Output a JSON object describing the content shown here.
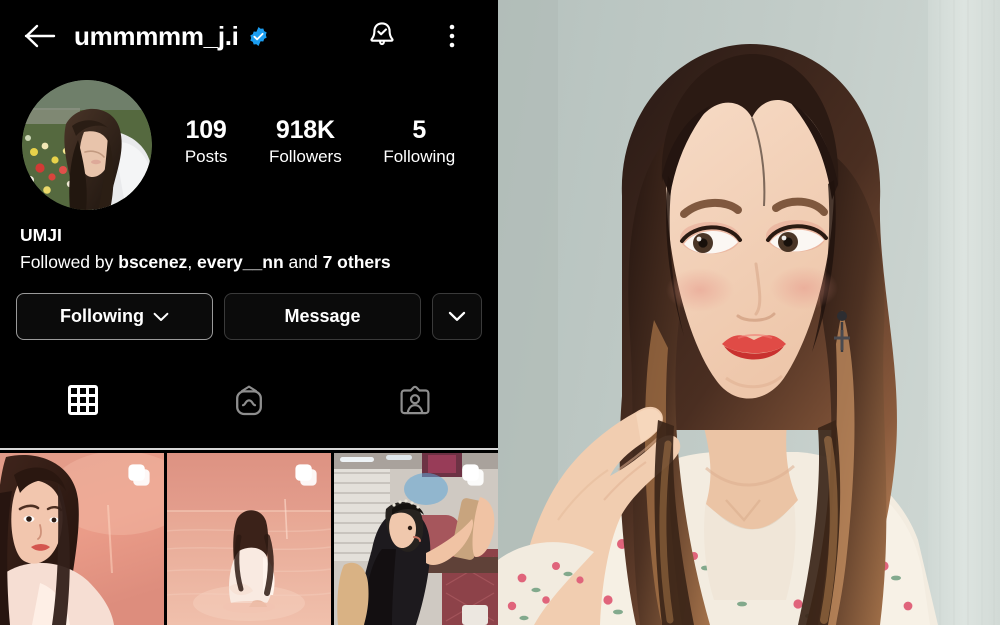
{
  "app": {
    "name": "Instagram profile screenshot"
  },
  "header": {
    "back_icon": "arrow-left-icon",
    "username": "ummmmm_j.i",
    "verified_badge": "verified-icon",
    "verified_color": "#1b9df0",
    "notifications_icon": "bell-check-icon",
    "menu_icon": "three-dots-vertical-icon"
  },
  "profile": {
    "avatar_alt": "profile-picture-woman-in-flower-garden",
    "full_name": "UMJI",
    "followed_by_prefix": "Followed by ",
    "followed_by_user1": "bscenez",
    "followed_by_sep": ", ",
    "followed_by_user2": "every__nn",
    "followed_by_and": " and ",
    "followed_by_others": "7 others",
    "stats": [
      {
        "num": "109",
        "label": "Posts"
      },
      {
        "num": "918K",
        "label": "Followers"
      },
      {
        "num": "5",
        "label": "Following"
      }
    ]
  },
  "actions": {
    "following_label": "Following",
    "following_chevron": "chevron-down-icon",
    "message_label": "Message",
    "more_chevron": "chevron-down-icon"
  },
  "tabs": [
    {
      "name": "grid-tab",
      "icon": "grid-icon",
      "active": true
    },
    {
      "name": "igtv-tab",
      "icon": "igtv-icon",
      "active": false
    },
    {
      "name": "tagged-tab",
      "icon": "tagged-person-card-icon",
      "active": false
    }
  ],
  "posts": [
    {
      "alt": "post-portrait-white-shirt-pink-tone",
      "badge": "carousel-icon"
    },
    {
      "alt": "post-woman-sitting-in-pink-water",
      "badge": "carousel-icon"
    },
    {
      "alt": "post-selfie-inside-bus-black-lace-top",
      "badge": "carousel-icon"
    }
  ],
  "side_photo": {
    "alt": "portrait-woman-long-brown-hair-floral-top",
    "background_color": "#bdc8c4",
    "curtain_color": "#d6dedb"
  }
}
